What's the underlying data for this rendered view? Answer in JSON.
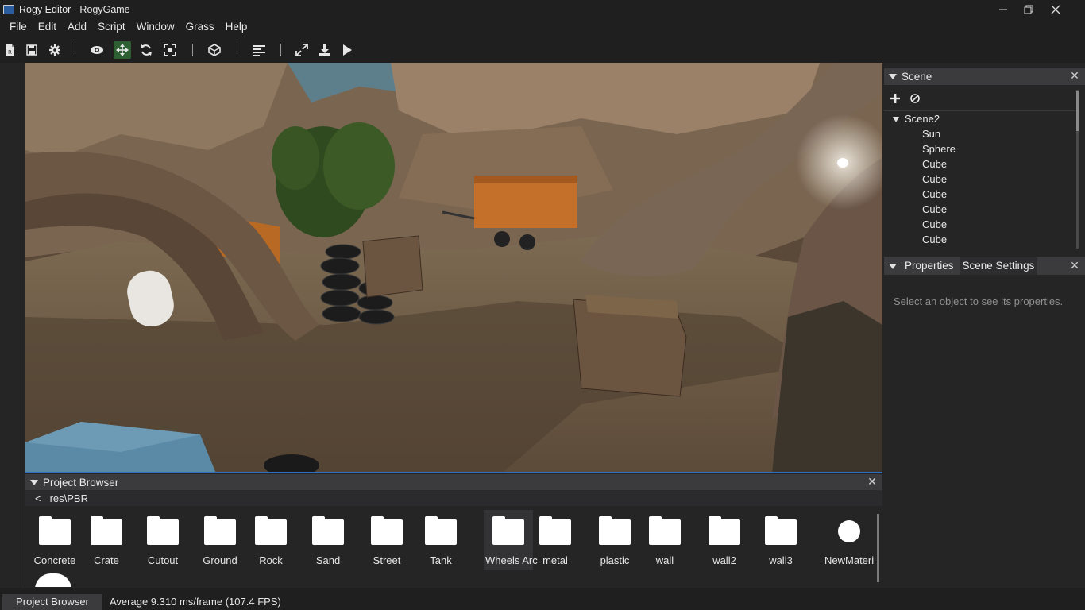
{
  "window": {
    "title": "Rogy Editor - RogyGame",
    "minimize_icon": "minimize-icon",
    "maximize_icon": "restore-icon",
    "close_icon": "close-icon"
  },
  "menu": [
    "File",
    "Edit",
    "Add",
    "Script",
    "Window",
    "Grass",
    "Help"
  ],
  "toolbar": {
    "icons": [
      "new-file-icon",
      "save-icon",
      "settings-icon",
      "eye-icon",
      "move-icon",
      "rotate-icon",
      "scale-icon",
      "cube-icon",
      "align-icon",
      "maximize-icon",
      "build-icon",
      "play-icon"
    ],
    "active": "move-icon",
    "accent": "#2e5f33"
  },
  "scene_panel": {
    "title": "Scene",
    "root": "Scene2",
    "items": [
      "Sun",
      "Sphere",
      "Cube",
      "Cube",
      "Cube",
      "Cube",
      "Cube",
      "Cube"
    ]
  },
  "properties_panel": {
    "tabs": [
      "Properties",
      "Scene Settings"
    ],
    "hint": "Select an object to see its properties."
  },
  "project_browser": {
    "title": "Project Browser",
    "back_label": "<",
    "path": "res\\PBR",
    "assets": [
      {
        "label": "Concrete",
        "kind": "folder"
      },
      {
        "label": "Crate",
        "kind": "folder"
      },
      {
        "label": "Cutout",
        "kind": "folder"
      },
      {
        "label": "Ground",
        "kind": "folder"
      },
      {
        "label": "Rock",
        "kind": "folder"
      },
      {
        "label": "Sand",
        "kind": "folder"
      },
      {
        "label": "Street",
        "kind": "folder"
      },
      {
        "label": "Tank",
        "kind": "folder"
      },
      {
        "label": "Wheels Arc",
        "kind": "folder"
      },
      {
        "label": "metal",
        "kind": "folder"
      },
      {
        "label": "plastic",
        "kind": "folder"
      },
      {
        "label": "wall",
        "kind": "folder"
      },
      {
        "label": "wall2",
        "kind": "folder"
      },
      {
        "label": "wall3",
        "kind": "folder"
      },
      {
        "label": "NewMateri",
        "kind": "material"
      }
    ]
  },
  "statusbar": {
    "tab": "Project Browser",
    "fps": "Average 9.310 ms/frame (107.4 FPS)"
  },
  "colors": {
    "background": "#252526",
    "panel_header": "#3b3b3d",
    "viewport_border": "#2f6fc0"
  }
}
